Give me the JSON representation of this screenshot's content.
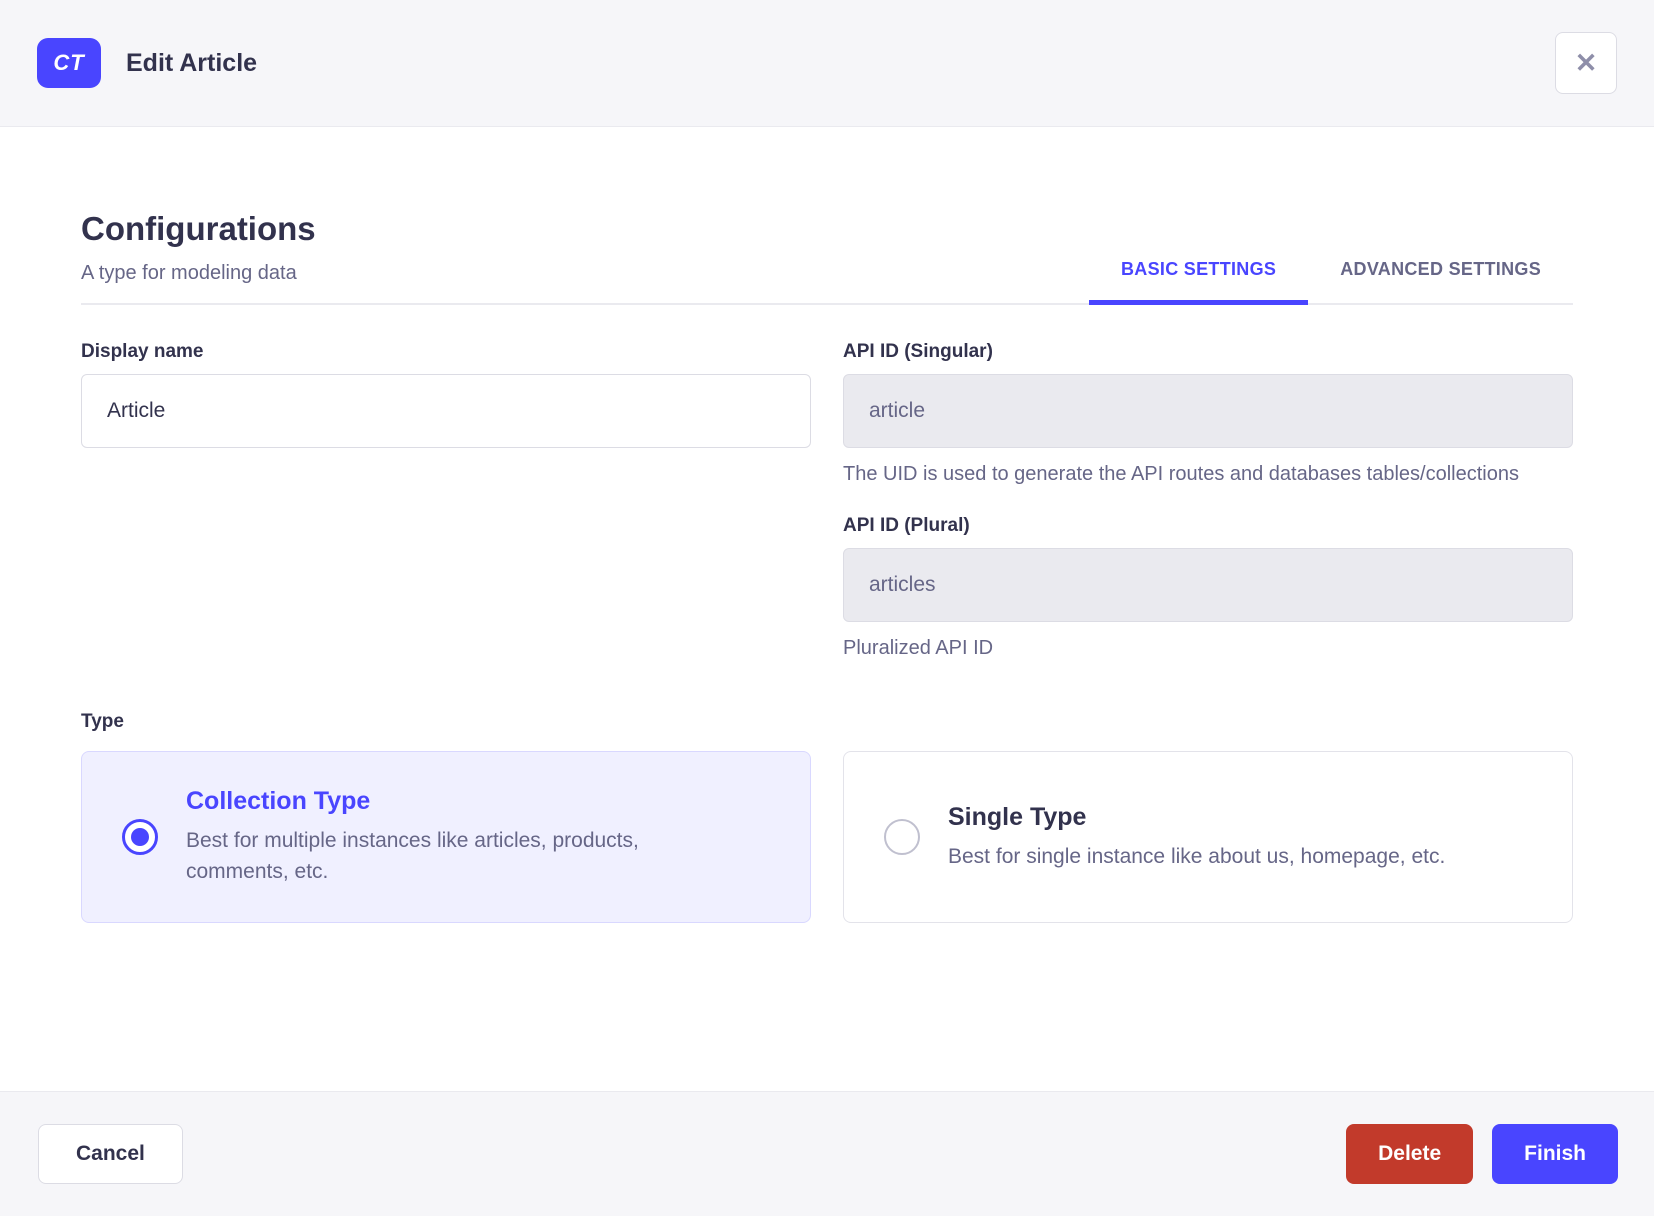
{
  "modal": {
    "badge": "CT",
    "title": "Edit Article"
  },
  "icons": {
    "close": "✕"
  },
  "intro": {
    "heading": "Configurations",
    "subheading": "A type for modeling data"
  },
  "tabs": [
    {
      "label": "BASIC SETTINGS",
      "active": true
    },
    {
      "label": "ADVANCED SETTINGS",
      "active": false
    }
  ],
  "form": {
    "display_name": {
      "label": "Display name",
      "value": "Article"
    },
    "api_id_singular": {
      "label": "API ID (Singular)",
      "value": "article",
      "hint": "The UID is used to generate the API routes and databases tables/collections"
    },
    "api_id_plural": {
      "label": "API ID (Plural)",
      "value": "articles",
      "hint": "Pluralized API ID"
    },
    "type": {
      "label": "Type",
      "options": [
        {
          "title": "Collection Type",
          "description": "Best for multiple instances like articles, products, comments, etc.",
          "selected": true
        },
        {
          "title": "Single Type",
          "description": "Best for single instance like about us, homepage, etc.",
          "selected": false
        }
      ]
    }
  },
  "footer": {
    "cancel": "Cancel",
    "delete": "Delete",
    "finish": "Finish"
  },
  "colors": {
    "primary": "#4945ff",
    "danger": "#c23a2b",
    "text_dark": "#32324d",
    "text_gray": "#666687",
    "surface_gray": "#f6f6f9",
    "border_light": "#eaeaef",
    "border_input": "#dcdce4",
    "selected_card_bg": "#f0f0ff",
    "disabled_input_bg": "#eaeaef"
  }
}
